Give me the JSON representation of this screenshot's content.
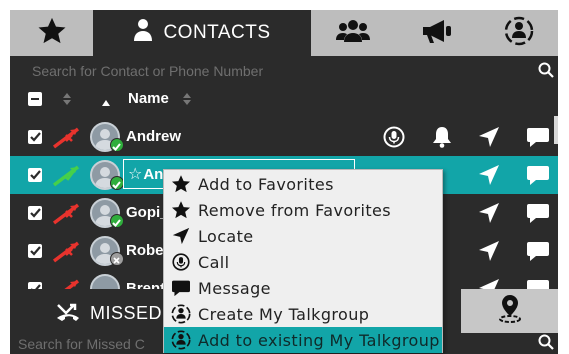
{
  "tabs": [
    {
      "icon": "star-icon"
    },
    {
      "icon": "person-icon",
      "label": "CONTACTS"
    },
    {
      "icon": "group-icon"
    },
    {
      "icon": "megaphone-icon"
    },
    {
      "icon": "talkgroup-icon"
    }
  ],
  "search": {
    "placeholder": "Search for Contact or Phone Number"
  },
  "header": {
    "name_label": "Name"
  },
  "contacts": [
    {
      "name": "Andrew",
      "checked": true,
      "status": "offline",
      "presence": "available"
    },
    {
      "name": "Ant",
      "checked": true,
      "status": "online",
      "presence": "available",
      "selected": true,
      "editing": true
    },
    {
      "name": "Gopi_",
      "checked": true,
      "status": "offline",
      "presence": "available"
    },
    {
      "name": "Robe",
      "checked": true,
      "status": "offline",
      "presence": "offline"
    },
    {
      "name": "Brent",
      "checked": true,
      "status": "offline",
      "presence": "available"
    }
  ],
  "context_menu": {
    "items": [
      {
        "label": "Add to Favorites",
        "icon": "star-icon"
      },
      {
        "label": "Remove from Favorites",
        "icon": "star-icon"
      },
      {
        "label": "Locate",
        "icon": "location-arrow-icon"
      },
      {
        "label": "Call",
        "icon": "mic-icon"
      },
      {
        "label": "Message",
        "icon": "chat-icon"
      },
      {
        "label": "Create My Talkgroup",
        "icon": "talkgroup-icon"
      },
      {
        "label": "Add to existing My Talkgroup",
        "icon": "talkgroup-icon",
        "highlighted": true
      }
    ]
  },
  "bottom": {
    "missed_label": "MISSED",
    "search_placeholder": "Search for Missed C"
  },
  "colors": {
    "accent": "#12a5a8",
    "panel": "#2b2b2b",
    "online": "#2fae3c",
    "offline": "#e8332d"
  }
}
